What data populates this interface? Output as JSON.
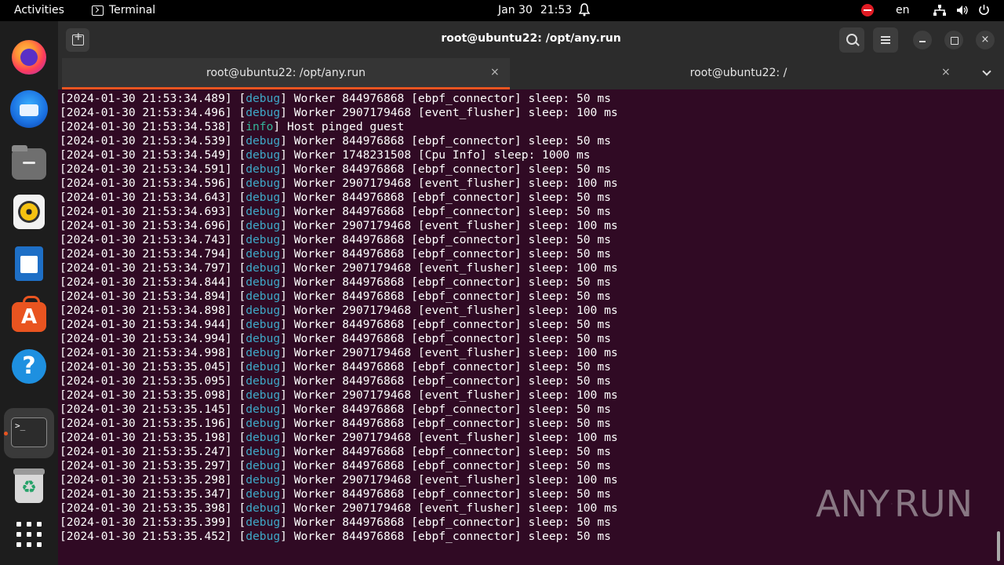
{
  "topbar": {
    "activities": "Activities",
    "app_name": "Terminal",
    "date": "Jan 30",
    "time": "21:53",
    "language": "en"
  },
  "dock": {
    "items": [
      "firefox",
      "thunderbird",
      "files",
      "rhythmbox",
      "libreoffice-writer",
      "app-center",
      "help",
      "terminal",
      "trash",
      "show-apps"
    ]
  },
  "window": {
    "title": "root@ubuntu22: /opt/any.run",
    "tabs": [
      {
        "label": "root@ubuntu22: /opt/any.run",
        "active": true
      },
      {
        "label": "root@ubuntu22: /",
        "active": false
      }
    ],
    "close_glyph": "×"
  },
  "log": [
    {
      "ts": "[2024-01-30 21:53:34.489]",
      "level": "debug",
      "msg": "Worker 844976868 [ebpf_connector] sleep: 50 ms"
    },
    {
      "ts": "[2024-01-30 21:53:34.496]",
      "level": "debug",
      "msg": "Worker 2907179468 [event_flusher] sleep: 100 ms"
    },
    {
      "ts": "[2024-01-30 21:53:34.538]",
      "level": "info",
      "msg": "Host pinged guest"
    },
    {
      "ts": "[2024-01-30 21:53:34.539]",
      "level": "debug",
      "msg": "Worker 844976868 [ebpf_connector] sleep: 50 ms"
    },
    {
      "ts": "[2024-01-30 21:53:34.549]",
      "level": "debug",
      "msg": "Worker 1748231508 [Cpu Info] sleep: 1000 ms"
    },
    {
      "ts": "[2024-01-30 21:53:34.591]",
      "level": "debug",
      "msg": "Worker 844976868 [ebpf_connector] sleep: 50 ms"
    },
    {
      "ts": "[2024-01-30 21:53:34.596]",
      "level": "debug",
      "msg": "Worker 2907179468 [event_flusher] sleep: 100 ms"
    },
    {
      "ts": "[2024-01-30 21:53:34.643]",
      "level": "debug",
      "msg": "Worker 844976868 [ebpf_connector] sleep: 50 ms"
    },
    {
      "ts": "[2024-01-30 21:53:34.693]",
      "level": "debug",
      "msg": "Worker 844976868 [ebpf_connector] sleep: 50 ms"
    },
    {
      "ts": "[2024-01-30 21:53:34.696]",
      "level": "debug",
      "msg": "Worker 2907179468 [event_flusher] sleep: 100 ms"
    },
    {
      "ts": "[2024-01-30 21:53:34.743]",
      "level": "debug",
      "msg": "Worker 844976868 [ebpf_connector] sleep: 50 ms"
    },
    {
      "ts": "[2024-01-30 21:53:34.794]",
      "level": "debug",
      "msg": "Worker 844976868 [ebpf_connector] sleep: 50 ms"
    },
    {
      "ts": "[2024-01-30 21:53:34.797]",
      "level": "debug",
      "msg": "Worker 2907179468 [event_flusher] sleep: 100 ms"
    },
    {
      "ts": "[2024-01-30 21:53:34.844]",
      "level": "debug",
      "msg": "Worker 844976868 [ebpf_connector] sleep: 50 ms"
    },
    {
      "ts": "[2024-01-30 21:53:34.894]",
      "level": "debug",
      "msg": "Worker 844976868 [ebpf_connector] sleep: 50 ms"
    },
    {
      "ts": "[2024-01-30 21:53:34.898]",
      "level": "debug",
      "msg": "Worker 2907179468 [event_flusher] sleep: 100 ms"
    },
    {
      "ts": "[2024-01-30 21:53:34.944]",
      "level": "debug",
      "msg": "Worker 844976868 [ebpf_connector] sleep: 50 ms"
    },
    {
      "ts": "[2024-01-30 21:53:34.994]",
      "level": "debug",
      "msg": "Worker 844976868 [ebpf_connector] sleep: 50 ms"
    },
    {
      "ts": "[2024-01-30 21:53:34.998]",
      "level": "debug",
      "msg": "Worker 2907179468 [event_flusher] sleep: 100 ms"
    },
    {
      "ts": "[2024-01-30 21:53:35.045]",
      "level": "debug",
      "msg": "Worker 844976868 [ebpf_connector] sleep: 50 ms"
    },
    {
      "ts": "[2024-01-30 21:53:35.095]",
      "level": "debug",
      "msg": "Worker 844976868 [ebpf_connector] sleep: 50 ms"
    },
    {
      "ts": "[2024-01-30 21:53:35.098]",
      "level": "debug",
      "msg": "Worker 2907179468 [event_flusher] sleep: 100 ms"
    },
    {
      "ts": "[2024-01-30 21:53:35.145]",
      "level": "debug",
      "msg": "Worker 844976868 [ebpf_connector] sleep: 50 ms"
    },
    {
      "ts": "[2024-01-30 21:53:35.196]",
      "level": "debug",
      "msg": "Worker 844976868 [ebpf_connector] sleep: 50 ms"
    },
    {
      "ts": "[2024-01-30 21:53:35.198]",
      "level": "debug",
      "msg": "Worker 2907179468 [event_flusher] sleep: 100 ms"
    },
    {
      "ts": "[2024-01-30 21:53:35.247]",
      "level": "debug",
      "msg": "Worker 844976868 [ebpf_connector] sleep: 50 ms"
    },
    {
      "ts": "[2024-01-30 21:53:35.297]",
      "level": "debug",
      "msg": "Worker 844976868 [ebpf_connector] sleep: 50 ms"
    },
    {
      "ts": "[2024-01-30 21:53:35.298]",
      "level": "debug",
      "msg": "Worker 2907179468 [event_flusher] sleep: 100 ms"
    },
    {
      "ts": "[2024-01-30 21:53:35.347]",
      "level": "debug",
      "msg": "Worker 844976868 [ebpf_connector] sleep: 50 ms"
    },
    {
      "ts": "[2024-01-30 21:53:35.398]",
      "level": "debug",
      "msg": "Worker 2907179468 [event_flusher] sleep: 100 ms"
    },
    {
      "ts": "[2024-01-30 21:53:35.399]",
      "level": "debug",
      "msg": "Worker 844976868 [ebpf_connector] sleep: 50 ms"
    },
    {
      "ts": "[2024-01-30 21:53:35.452]",
      "level": "debug",
      "msg": "Worker 844976868 [ebpf_connector] sleep: 50 ms"
    }
  ],
  "watermark": {
    "left": "ANY",
    "right": "RUN"
  },
  "colors": {
    "terminal_bg": "#300a24",
    "debug": "#3fa8c8",
    "info": "#34b59a",
    "accent": "#e95420"
  }
}
